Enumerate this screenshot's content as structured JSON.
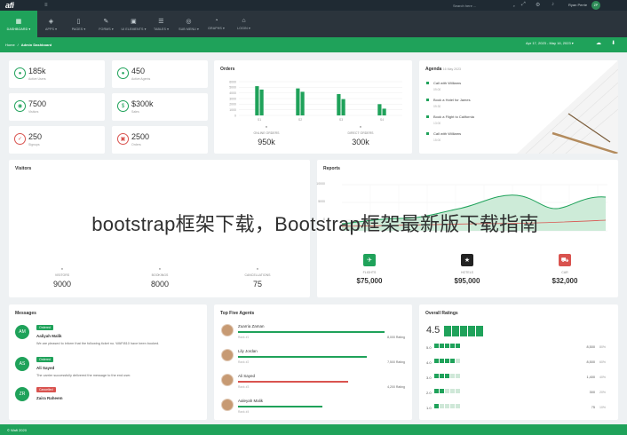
{
  "app": {
    "logo": "afi",
    "menu_icon": "hamburger-icon"
  },
  "topbar": {
    "search_placeholder": "Search here ...",
    "user_name": "Ryan Perrie",
    "user_initials": "ZP"
  },
  "nav": [
    {
      "label": "DASHBOARD ▾",
      "icon": "dashboard-icon"
    },
    {
      "label": "APPS ▾",
      "icon": "cube-icon"
    },
    {
      "label": "PAGES ▾",
      "icon": "pages-icon"
    },
    {
      "label": "FORMS ▾",
      "icon": "edit-icon"
    },
    {
      "label": "UI ELEMENTS ▾",
      "icon": "layers-icon"
    },
    {
      "label": "TABLES ▾",
      "icon": "table-icon"
    },
    {
      "label": "SUB MENU ▾",
      "icon": "submenu-icon"
    },
    {
      "label": "GRAPHS ▾",
      "icon": "pie-icon"
    },
    {
      "label": "LOGIN ▾",
      "icon": "lock-icon"
    }
  ],
  "breadcrumb": {
    "home": "Home",
    "current": "Admin Dashboard"
  },
  "date_range": "Apr 17, 2023 - May 16, 2023 ▾",
  "stats": [
    {
      "value": "185k",
      "label": "Active Users",
      "color": "#1fa25a",
      "icon": "user-icon"
    },
    {
      "value": "450",
      "label": "Active Agents",
      "color": "#1fa25a",
      "icon": "agent-icon"
    },
    {
      "value": "7500",
      "label": "Visitors",
      "color": "#1fa25a",
      "icon": "eye-icon"
    },
    {
      "value": "$300k",
      "label": "Sales",
      "color": "#1fa25a",
      "icon": "dollar-icon"
    },
    {
      "value": "250",
      "label": "Signups",
      "color": "#d9534f",
      "icon": "check-icon"
    },
    {
      "value": "2500",
      "label": "Orders",
      "color": "#d9534f",
      "icon": "cart-icon"
    }
  ],
  "orders": {
    "title": "Orders",
    "online_label": "ONLINE ORDERS",
    "online_value": "950k",
    "direct_label": "DIRECT ORDERS",
    "direct_value": "300k"
  },
  "chart_data": {
    "type": "bar",
    "title": "Orders",
    "categories": [
      "S1",
      "S2",
      "S3",
      "S4"
    ],
    "y_ticks": [
      "6000",
      "5000",
      "4000",
      "3000",
      "2000",
      "1000",
      "0"
    ],
    "ylim": [
      0,
      6000
    ],
    "series": [
      {
        "values": [
          5200,
          4800,
          3800,
          2000
        ]
      },
      {
        "values": [
          4600,
          4200,
          2900,
          1200
        ]
      }
    ],
    "color": "#1fa25a"
  },
  "agenda": {
    "title": "Agenda",
    "date": "16 May 2023",
    "items": [
      {
        "text": "Call with Williams",
        "time": "09:00"
      },
      {
        "text": "Book a Hotel for James",
        "time": "09:30"
      },
      {
        "text": "Book a Flight to California",
        "time": "13:00"
      },
      {
        "text": "Call with Williams",
        "time": "15:00"
      }
    ]
  },
  "visitors": {
    "title": "Visitors",
    "items": [
      {
        "label": "VISITORS",
        "value": "9000"
      },
      {
        "label": "BOOKINGS",
        "value": "8000"
      },
      {
        "label": "CANCELLATIONS",
        "value": "75"
      }
    ]
  },
  "reports": {
    "title": "Reports",
    "y_ticks": [
      "10000",
      "5000",
      "0"
    ],
    "items": [
      {
        "label": "FLIGHTS",
        "value": "$75,000",
        "color": "#1fa25a",
        "icon": "plane-icon"
      },
      {
        "label": "HOTELS",
        "value": "$95,000",
        "color": "#222222",
        "icon": "star-icon"
      },
      {
        "label": "CAR",
        "value": "$32,000",
        "color": "#d9534f",
        "icon": "car-icon"
      }
    ]
  },
  "messages": {
    "title": "Messages",
    "items": [
      {
        "initials": "AM",
        "badge": "Ordered",
        "name": "Aaliyah Malik",
        "text": "We are pleased to inform that the following ticket no. WAFI810 have been booked.",
        "badge_color": "green"
      },
      {
        "initials": "AS",
        "badge": "Ordered",
        "name": "Ali Sayed",
        "text": "The carrier successfully delivered the message to the end user.",
        "badge_color": "green"
      },
      {
        "initials": "ZR",
        "badge": "Cancelled",
        "name": "Zaira Raheem",
        "text": "",
        "badge_color": "red"
      }
    ]
  },
  "agents": {
    "title": "Top Five Agents",
    "items": [
      {
        "name": "Zuarria Zaman",
        "rank": "Rank #1",
        "rating": "8,000 Rating",
        "color": "#1fa25a",
        "fill": 0.93
      },
      {
        "name": "Lily Jordan",
        "rank": "Rank #2",
        "rating": "7,500 Rating",
        "color": "#1fa25a",
        "fill": 0.76
      },
      {
        "name": "Ali Sayed",
        "rank": "Rank #3",
        "rating": "4,200 Rating",
        "color": "#d9534f",
        "fill": 0.65
      },
      {
        "name": "Aaleyah Malik",
        "rank": "Rank #4",
        "rating": "",
        "color": "#1fa25a",
        "fill": 0.5
      }
    ]
  },
  "ratings": {
    "title": "Overall Ratings",
    "score": "4.5",
    "rows": [
      {
        "n": "5.0",
        "count": "8,500",
        "pct": "80%"
      },
      {
        "n": "4.0",
        "count": "8,500",
        "pct": "60%"
      },
      {
        "n": "3.0",
        "count": "1,400",
        "pct": "40%"
      },
      {
        "n": "2.0",
        "count": "300",
        "pct": "20%"
      },
      {
        "n": "1.0",
        "count": "75",
        "pct": "10%"
      }
    ]
  },
  "overlay_text": "bootstrap框架下载，Bootstrap框架最新版下载指南",
  "footer": "© Wafi 2020"
}
